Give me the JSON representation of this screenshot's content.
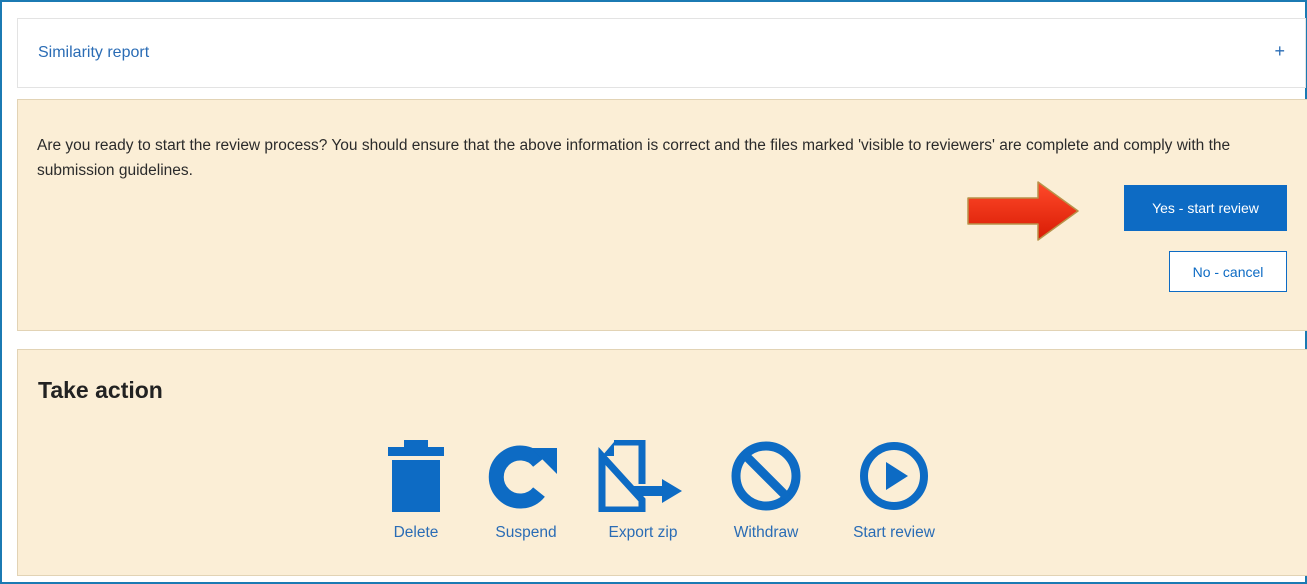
{
  "similarity_section": {
    "title": "Similarity report",
    "expand_symbol": "+"
  },
  "confirm_dialog": {
    "message": "Are you ready to start the review process? You should ensure that the above information is correct and the files marked 'visible to reviewers' are complete and comply with the submission guidelines.",
    "yes_label": "Yes - start review",
    "no_label": "No - cancel",
    "arrow_icon": "red-arrow-right-icon"
  },
  "take_action": {
    "heading": "Take action",
    "items": [
      {
        "label": "Delete",
        "icon": "trash-icon"
      },
      {
        "label": "Suspend",
        "icon": "refresh-icon"
      },
      {
        "label": "Export zip",
        "icon": "export-icon"
      },
      {
        "label": "Withdraw",
        "icon": "prohibited-icon"
      },
      {
        "label": "Start review",
        "icon": "play-circle-icon"
      }
    ]
  },
  "colors": {
    "accent": "#0d6bc4",
    "link": "#2a6cb5",
    "panel_bg": "#fbeed6",
    "frame_border": "#1b7ab3",
    "arrow": "#ee2a0e"
  }
}
